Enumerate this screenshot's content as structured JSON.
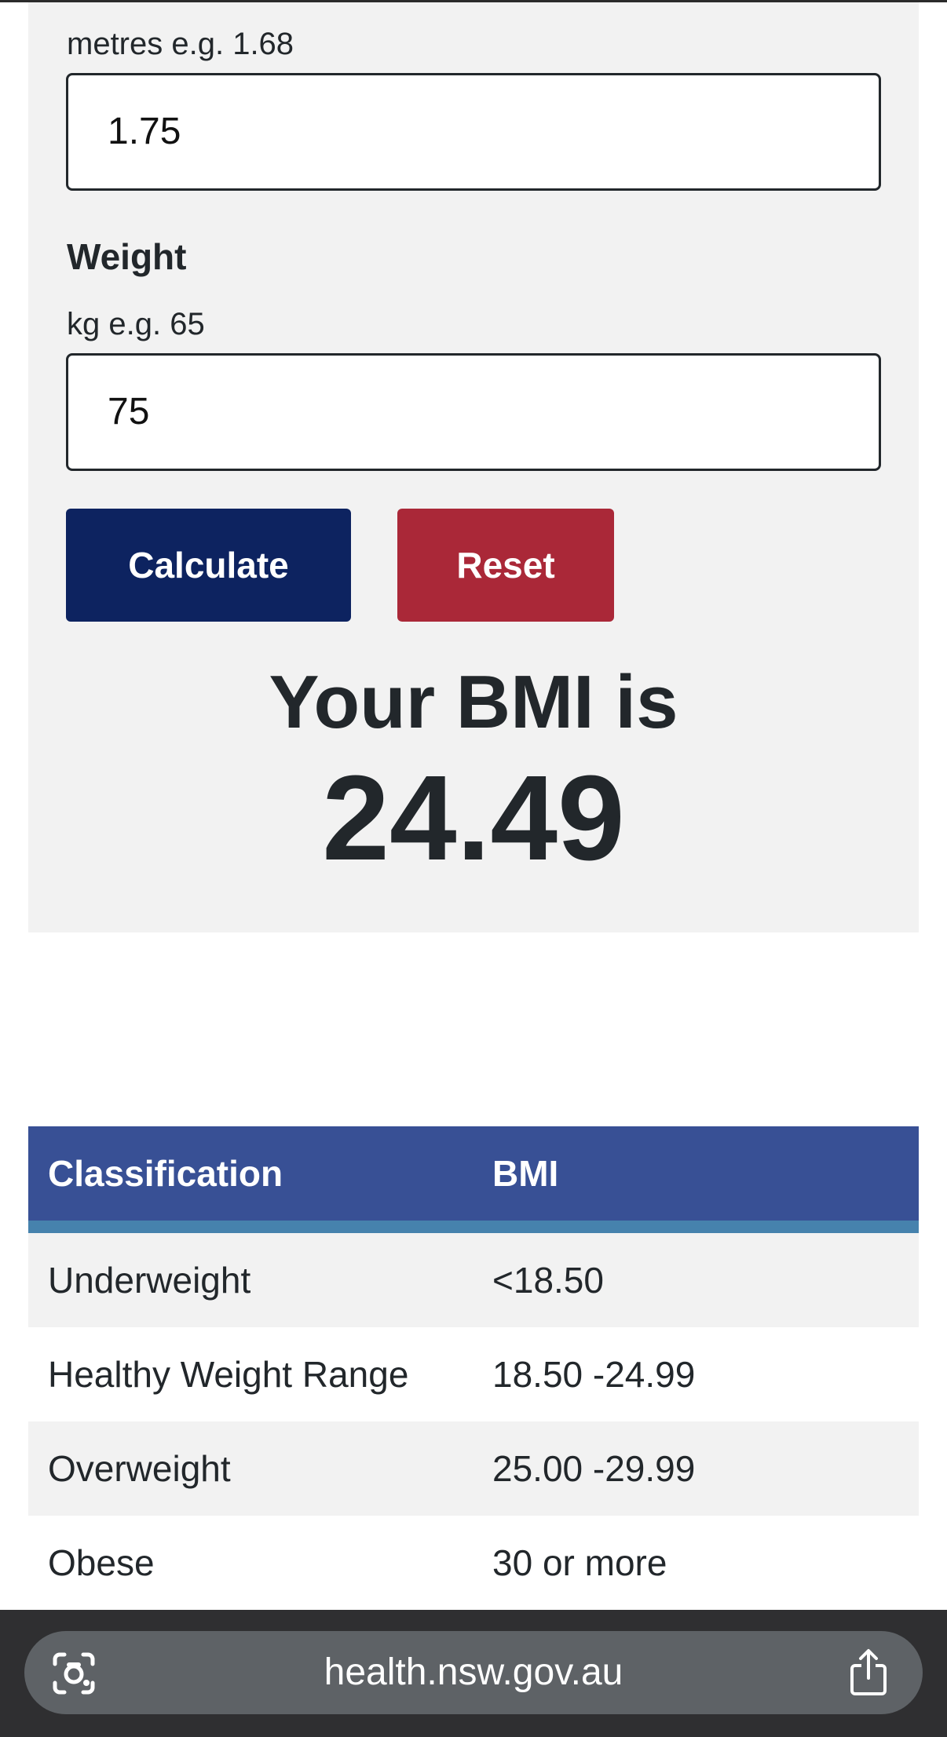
{
  "form": {
    "height_hint": "metres e.g. 1.68",
    "height_value": "1.75",
    "weight_label": "Weight",
    "weight_hint": "kg e.g. 65",
    "weight_value": "75",
    "calculate_label": "Calculate",
    "reset_label": "Reset"
  },
  "result": {
    "label": "Your BMI is",
    "value": "24.49"
  },
  "table": {
    "headers": [
      "Classification",
      "BMI"
    ],
    "rows": [
      [
        "Underweight",
        "<18.50"
      ],
      [
        "Healthy Weight Range",
        "18.50 -24.99"
      ],
      [
        "Overweight",
        "25.00 -29.99"
      ],
      [
        "Obese",
        "30 or more"
      ]
    ]
  },
  "browser": {
    "url": "health.nsw.gov.au",
    "left_icon": "visual-lookup-icon",
    "right_icon": "share-icon"
  },
  "colors": {
    "calculate": "#0d2360",
    "reset": "#aa2838",
    "table_header": "#385095",
    "table_stripe": "#4682ad"
  }
}
